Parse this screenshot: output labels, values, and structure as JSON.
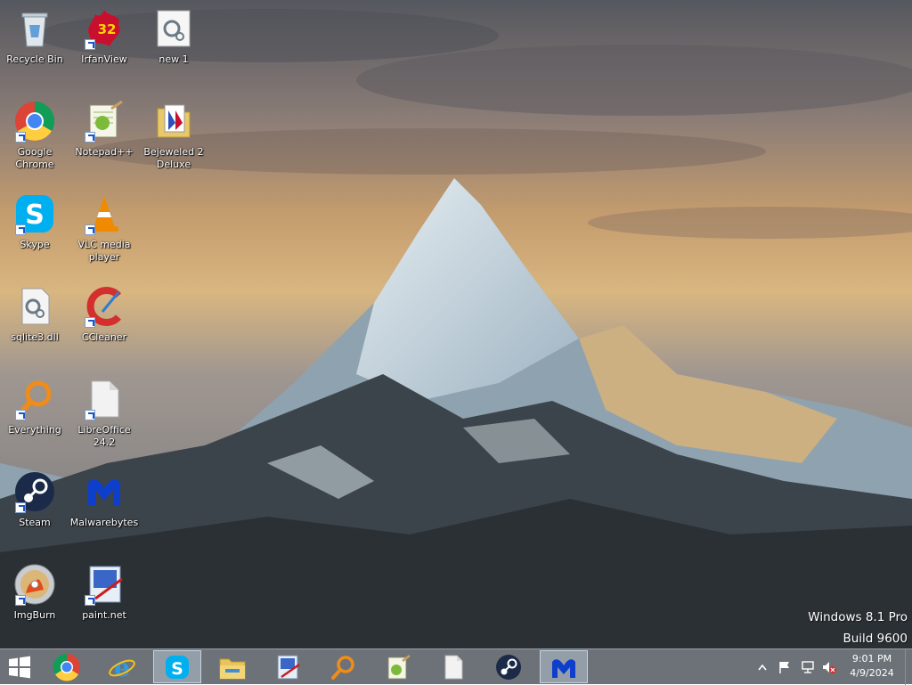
{
  "desktop_icons": [
    {
      "label": "Recycle Bin",
      "icon": "recycle-bin-icon"
    },
    {
      "label": "IrfanView",
      "icon": "irfanview-icon"
    },
    {
      "label": "new 1",
      "icon": "settings-file-icon"
    },
    {
      "label": "Google Chrome",
      "icon": "chrome-icon"
    },
    {
      "label": "Notepad++",
      "icon": "notepadpp-icon"
    },
    {
      "label": "Bejeweled 2 Deluxe",
      "icon": "folder-icon"
    },
    {
      "label": "Skype",
      "icon": "skype-icon"
    },
    {
      "label": "VLC media player",
      "icon": "vlc-icon"
    },
    {
      "label": "sqlite3.dll",
      "icon": "dll-file-icon"
    },
    {
      "label": "CCleaner",
      "icon": "ccleaner-icon"
    },
    {
      "label": "Everything",
      "icon": "everything-icon"
    },
    {
      "label": "LibreOffice 24.2",
      "icon": "libreoffice-icon"
    },
    {
      "label": "Steam",
      "icon": "steam-icon"
    },
    {
      "label": "Malwarebytes",
      "icon": "malwarebytes-icon"
    },
    {
      "label": "ImgBurn",
      "icon": "imgburn-icon"
    },
    {
      "label": "paint.net",
      "icon": "paintnet-icon"
    }
  ],
  "watermark": {
    "edition": "Windows 8.1 Pro",
    "build": "Build 9600"
  },
  "irfanview_badge": "32",
  "taskbar": {
    "items": [
      {
        "icon": "windows-start-icon"
      },
      {
        "icon": "chrome-icon"
      },
      {
        "icon": "internet-explorer-icon"
      },
      {
        "icon": "skype-icon"
      },
      {
        "icon": "file-explorer-icon"
      },
      {
        "icon": "paintnet-icon"
      },
      {
        "icon": "everything-icon"
      },
      {
        "icon": "notepadpp-icon"
      },
      {
        "icon": "libreoffice-icon"
      },
      {
        "icon": "steam-icon"
      },
      {
        "icon": "malwarebytes-icon"
      }
    ],
    "tray": {
      "time": "9:01 PM",
      "date": "4/9/2024"
    }
  },
  "colors": {
    "taskbar": "#646a70",
    "chrome_red": "#db4437",
    "skype_blue": "#00aff0",
    "malwarebytes_blue": "#0d3ecc"
  }
}
